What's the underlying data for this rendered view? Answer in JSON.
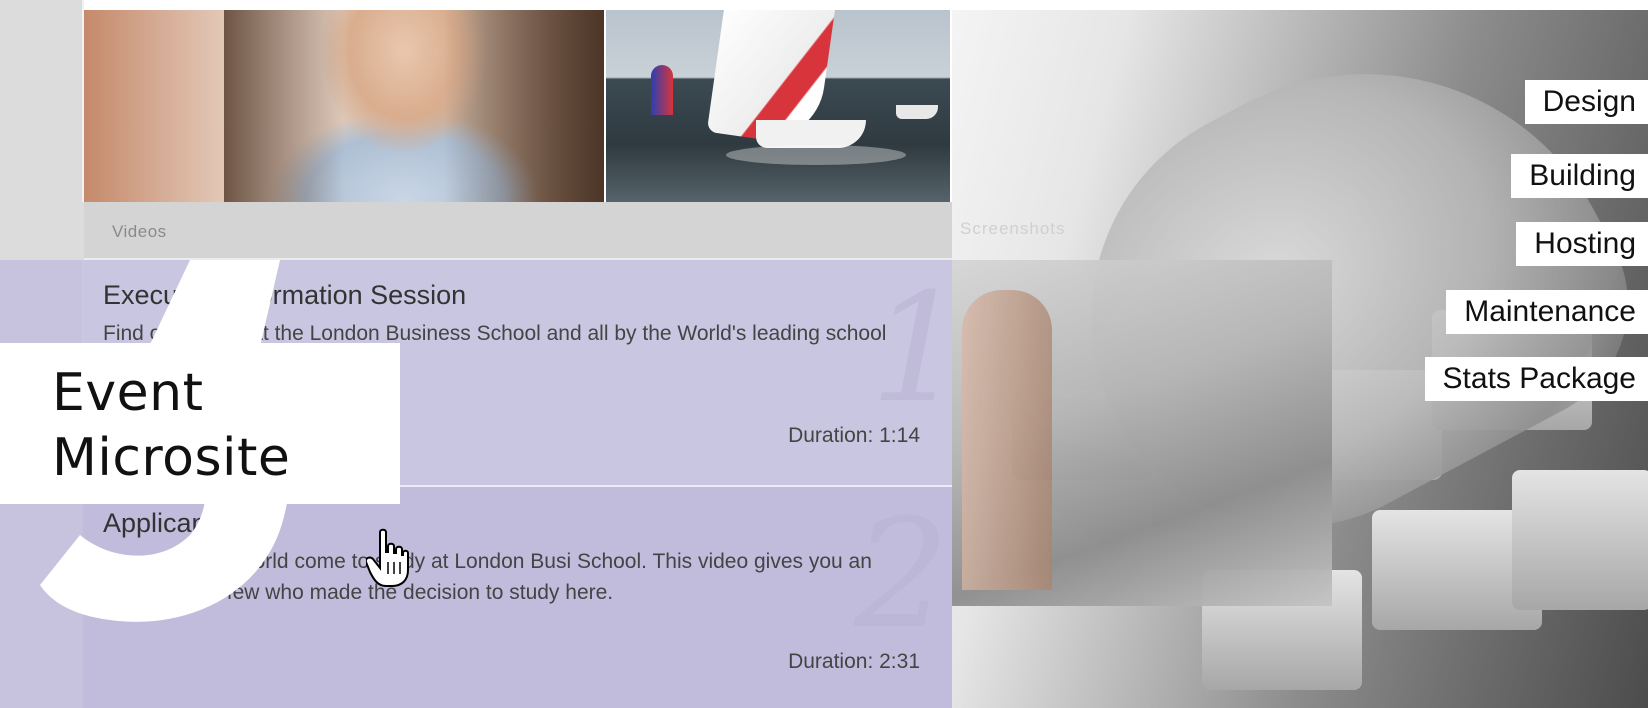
{
  "sections": {
    "videos_label": "Videos",
    "screenshots_label": "Screenshots"
  },
  "videos": [
    {
      "title": "Execu BA Information Session",
      "description": "Find o studying at the London Business School and all by the World's leading school for",
      "duration": "Duration: 1:14",
      "number": "1"
    },
    {
      "title": "Applicant",
      "description": "eop m around world come to study at London Busi School. This video gives you an insight into a few who made the decision to study here.",
      "duration": "Duration: 2:31",
      "number": "2"
    }
  ],
  "overlay": {
    "title_line1": "Event",
    "title_line2": "Microsite"
  },
  "services": {
    "design": "Design",
    "building": "Building",
    "hosting": "Hosting",
    "maintenance": "Maintenance",
    "stats": "Stats Package"
  },
  "colors": {
    "panel_purple": "#c9c6e1",
    "rail_gray": "#dcdcdc",
    "text_dark": "#333333"
  }
}
